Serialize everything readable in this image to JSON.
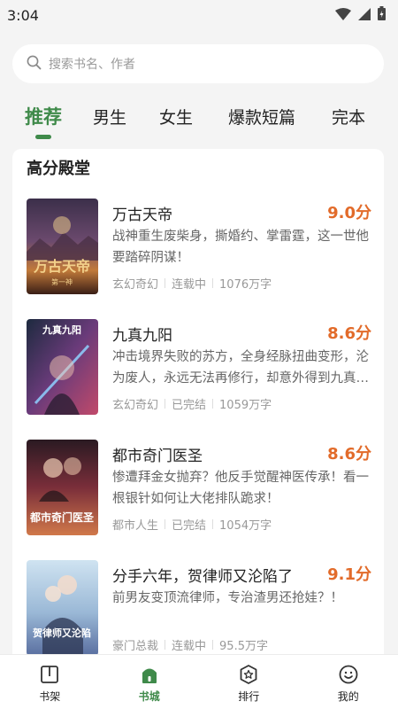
{
  "status_bar": {
    "time": "3:04"
  },
  "search": {
    "placeholder": "搜索书名、作者"
  },
  "tabs": [
    {
      "label": "推荐"
    },
    {
      "label": "男生"
    },
    {
      "label": "女生"
    },
    {
      "label": "爆款短篇"
    },
    {
      "label": "完本"
    }
  ],
  "section": {
    "title": "高分殿堂"
  },
  "books": [
    {
      "title": "万古天帝",
      "score": "9.0分",
      "desc": "战神重生废柴身，撕婚约、掌雷霆，这一世他要踏碎阴谋！",
      "genre": "玄幻奇幻",
      "status": "连载中",
      "words": "1076万字",
      "cover_text": "万古天帝",
      "cover_sub": "第一神"
    },
    {
      "title": "九真九阳",
      "score": "8.6分",
      "desc": "冲击境界失败的苏方，全身经脉扭曲变形，沦为废人，永远无法再修行，却意外得到九真九阳传承。",
      "genre": "玄幻奇幻",
      "status": "已完结",
      "words": "1059万字",
      "cover_text": "九真九阳"
    },
    {
      "title": "都市奇门医圣",
      "score": "8.6分",
      "desc": "惨遭拜金女抛弃？他反手觉醒神医传承！看一根银针如何让大佬排队跪求！",
      "genre": "都市人生",
      "status": "已完结",
      "words": "1054万字",
      "cover_text": "都市奇门医圣"
    },
    {
      "title": "分手六年，贺律师又沦陷了",
      "score": "9.1分",
      "desc": "前男友变顶流律师，专治渣男还抢娃？！",
      "genre": "豪门总裁",
      "status": "连载中",
      "words": "95.5万字",
      "cover_text": "贺律师又沦陷"
    }
  ],
  "bottom_nav": [
    {
      "label": "书架",
      "icon": "book-icon"
    },
    {
      "label": "书城",
      "icon": "home-icon"
    },
    {
      "label": "排行",
      "icon": "ranking-badge-icon"
    },
    {
      "label": "我的",
      "icon": "smiley-face-icon"
    }
  ],
  "colors": {
    "accent": "#3f8a4a",
    "score": "#e26b2a",
    "background": "#f4f4f4"
  }
}
